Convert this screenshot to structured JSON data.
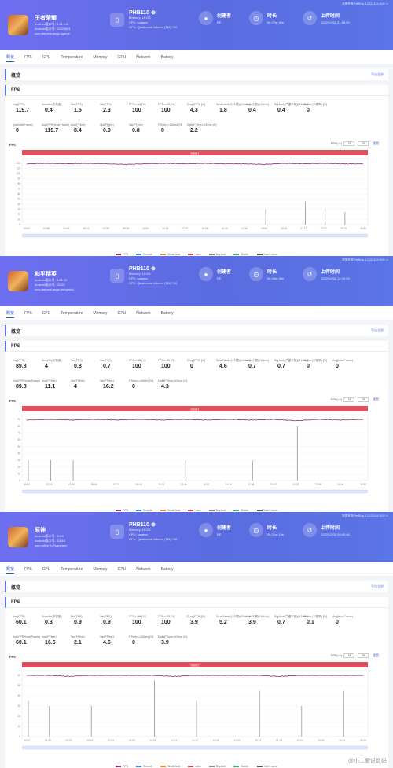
{
  "panels": [
    {
      "game": {
        "name": "王者荣耀",
        "meta1": "Android版本号: 3.81.1.8",
        "meta2": "Android版本号: 20220801",
        "pkg": "com.tencent.tmgp.sgame",
        "icon": "game-icon-warrior"
      },
      "device": {
        "name": "PHB110 ⊕",
        "line1": "Memory: 16.0G",
        "line2": "CPU: kalama",
        "line3": "GPU: Qualcomm Adreno (TM) 740",
        "icon": "phone-icon"
      },
      "stats": [
        {
          "label": "创建者",
          "value": "EE",
          "icon": "user-icon"
        },
        {
          "label": "时长",
          "value": "0h 27m 30s",
          "icon": "clock-icon"
        },
        {
          "label": "上传时间",
          "value": "2022/12/02 21:56:00",
          "icon": "history-icon"
        }
      ],
      "header_note": "数据来源:PerfDog 8.2.221104.0000 ⊙",
      "breadcrumb_tab": "概览",
      "tabs": [
        "概览",
        "FPS",
        "CPU",
        "Temperature",
        "Memory",
        "GPU",
        "Network",
        "Battery"
      ],
      "section_title": "概览",
      "section_link": "导出全部",
      "fps_title": "FPS",
      "metric_rows": [
        [
          {
            "label": "Avg(FPS)",
            "value": "119.7"
          },
          {
            "label": "Smooth(平滑度)",
            "value": "0.4"
          },
          {
            "label": "Std(FPS)",
            "value": "1.5"
          },
          {
            "label": "Var(FPS)",
            "value": "2.3"
          },
          {
            "label": "FPS>=18 [%]",
            "value": "100"
          },
          {
            "label": "FPS>=25 [%]",
            "value": "100"
          },
          {
            "label": "Drop(FPS) [/h]",
            "value": "4.3"
          },
          {
            "label": "SmallJank(小卡顿)(/10min)",
            "value": "1.8"
          },
          {
            "label": "Jank(卡顿)(/10min)",
            "value": "0.4"
          },
          {
            "label": "BigJank(严重卡顿)(/10min)",
            "value": "0.4"
          },
          {
            "label": "Stutter(卡顿率) [%]",
            "value": "0"
          }
        ],
        [
          {
            "label": "Avg(InterFrame)",
            "value": "0"
          },
          {
            "label": "Avg(FPS+InterFrame)",
            "value": "119.7"
          },
          {
            "label": "Avg(FTime)",
            "value": "8.4"
          },
          {
            "label": "Std(FTime)",
            "value": "0.9"
          },
          {
            "label": "Var(FTime)",
            "value": "0.8"
          },
          {
            "label": "FTime>=100ms [%]",
            "value": "0"
          },
          {
            "label": "DeltaFTime>100ms [/h]",
            "value": "2.2"
          }
        ]
      ],
      "chart": {
        "label": "FPS",
        "controls_label": "FPS(>=)",
        "ctl1": "18",
        "ctl2": "25",
        "ctl_btn": "重置",
        "banner": "label1",
        "legend": [
          "FPS",
          "Smooth",
          "SmallJank",
          "Jank",
          "BigJank",
          "Stutter",
          "InterFrame"
        ]
      }
    },
    {
      "game": {
        "name": "和平精英",
        "meta1": "Android版本号: 1.21.19",
        "meta2": "Android版本号: 11120",
        "pkg": "com.tencent.tmgp.pubgmhd",
        "icon": "game-icon-soldier"
      },
      "device": {
        "name": "PHB110 ⊕",
        "line1": "Memory: 16.0G",
        "line2": "CPU: kalama",
        "line3": "GPU: Qualcomm Adreno (TM) 740",
        "icon": "phone-icon"
      },
      "stats": [
        {
          "label": "创建者",
          "value": "EE",
          "icon": "user-icon"
        },
        {
          "label": "时长",
          "value": "0h 28m 58s",
          "icon": "clock-icon"
        },
        {
          "label": "上传时间",
          "value": "2022/12/02 14:10:02",
          "icon": "history-icon"
        }
      ],
      "header_note": "数据来源:PerfDog 8.2.221104.0000 ⊙",
      "breadcrumb_tab": "概览",
      "tabs": [
        "概览",
        "FPS",
        "CPU",
        "Temperature",
        "Memory",
        "GPU",
        "Network",
        "Battery"
      ],
      "section_title": "概览",
      "section_link": "导出全部",
      "fps_title": "FPS",
      "metric_rows": [
        [
          {
            "label": "Avg(FPS)",
            "value": "89.8"
          },
          {
            "label": "Smooth(平滑度)",
            "value": "4"
          },
          {
            "label": "Std(FPS)",
            "value": "0.8"
          },
          {
            "label": "Var(FPS)",
            "value": "0.7"
          },
          {
            "label": "FPS>=18 [%]",
            "value": "100"
          },
          {
            "label": "FPS>=25 [%]",
            "value": "100"
          },
          {
            "label": "Drop(FPS) [/h]",
            "value": "0"
          },
          {
            "label": "SmallJank(小卡顿)(/10min)",
            "value": "4.6"
          },
          {
            "label": "Jank(卡顿)(/10min)",
            "value": "0.7"
          },
          {
            "label": "BigJank(严重卡顿)(/10min)",
            "value": "0.7"
          },
          {
            "label": "Stutter(卡顿率) [%]",
            "value": "0"
          },
          {
            "label": "Avg(InterFrame)",
            "value": "0"
          }
        ],
        [
          {
            "label": "Avg(FPS+InterFrame)",
            "value": "89.8"
          },
          {
            "label": "Avg(FTime)",
            "value": "11.1"
          },
          {
            "label": "Std(FTime)",
            "value": "4"
          },
          {
            "label": "Var(FTime)",
            "value": "16.2"
          },
          {
            "label": "FTime>=100ms [%]",
            "value": "0"
          },
          {
            "label": "DeltaFTime>100ms [/h]",
            "value": "4.3"
          }
        ]
      ],
      "chart": {
        "label": "FPS",
        "controls_label": "FPS(>=)",
        "ctl1": "18",
        "ctl2": "25",
        "ctl_btn": "重置",
        "banner": "label1",
        "legend": [
          "FPS",
          "Smooth",
          "SmallJank",
          "Jank",
          "BigJank",
          "Stutter",
          "InterFrame"
        ]
      }
    },
    {
      "game": {
        "name": "原神",
        "meta1": "Android版本号: 3.2.0",
        "meta2": "Android版本号: 11846",
        "pkg": "com.miHoYo.Yuanshen",
        "icon": "game-icon-genshin"
      },
      "device": {
        "name": "PHB110 ⊕",
        "line1": "Memory: 16.0G",
        "line2": "CPU: kalama",
        "line3": "GPU: Qualcomm Adreno (TM) 740",
        "icon": "phone-icon"
      },
      "stats": [
        {
          "label": "创建者",
          "value": "EE",
          "icon": "user-icon"
        },
        {
          "label": "时长",
          "value": "0h 31m 19s",
          "icon": "clock-icon"
        },
        {
          "label": "上传时间",
          "value": "2022/12/02 09:05:46",
          "icon": "history-icon"
        }
      ],
      "header_note": "数据来源:PerfDog 8.2.221104.0000 ⊙",
      "breadcrumb_tab": "概览",
      "tabs": [
        "概览",
        "FPS",
        "CPU",
        "Temperature",
        "Memory",
        "GPU",
        "Network",
        "Battery"
      ],
      "section_title": "概览",
      "section_link": "导出全部",
      "fps_title": "FPS",
      "metric_rows": [
        [
          {
            "label": "Avg(FPS)",
            "value": "60.1"
          },
          {
            "label": "Smooth(平滑度)",
            "value": "0.3"
          },
          {
            "label": "Std(FPS)",
            "value": "0.9"
          },
          {
            "label": "Var(FPS)",
            "value": "0.9"
          },
          {
            "label": "FPS>=18 [%]",
            "value": "100"
          },
          {
            "label": "FPS>=25 [%]",
            "value": "100"
          },
          {
            "label": "Drop(FPS) [/h]",
            "value": "3.9"
          },
          {
            "label": "SmallJank(小卡顿)(/10min)",
            "value": "5.2"
          },
          {
            "label": "Jank(卡顿)(/10min)",
            "value": "3.9"
          },
          {
            "label": "BigJank(严重卡顿)(/10min)",
            "value": "0.7"
          },
          {
            "label": "Stutter(卡顿率) [%]",
            "value": "0.1"
          },
          {
            "label": "Avg(InterFrame)",
            "value": "0"
          }
        ],
        [
          {
            "label": "Avg(FPS+InterFrame)",
            "value": "60.1"
          },
          {
            "label": "Avg(FTime)",
            "value": "16.6"
          },
          {
            "label": "Std(FTime)",
            "value": "2.1"
          },
          {
            "label": "Var(FTime)",
            "value": "4.6"
          },
          {
            "label": "FTime>=100ms [%]",
            "value": "0"
          },
          {
            "label": "DeltaFTime>100ms [/h]",
            "value": "3.9"
          }
        ]
      ],
      "chart": {
        "label": "FPS",
        "controls_label": "FPS(>=)",
        "ctl1": "18",
        "ctl2": "25",
        "ctl_btn": "重置",
        "banner": "label1",
        "legend": [
          "FPS",
          "Smooth",
          "SmallJank",
          "Jank",
          "BigJank",
          "Stutter",
          "InterFrame"
        ]
      }
    }
  ],
  "watermark": "@小二爱说数码",
  "colors": {
    "header": "#5b74e6",
    "fps_line": "#8b2d72",
    "banner": "#e0505f",
    "spike": "#a8a8a8",
    "accent": "#2f5bdc"
  },
  "chart_data": [
    {
      "type": "line",
      "ylim": [
        0,
        120
      ],
      "yticks": [
        "0",
        "10",
        "20",
        "30",
        "40",
        "50",
        "60",
        "70",
        "80",
        "90",
        "100",
        "110",
        "120"
      ],
      "x": [
        "00:00",
        "02:56",
        "04:46",
        "06:12",
        "07:26",
        "09:28",
        "10:52",
        "12:18",
        "13:40",
        "15:06",
        "16:30",
        "17:48",
        "19:06",
        "20:44",
        "22:12",
        "23:52",
        "25:10",
        "26:34"
      ],
      "series": [
        {
          "name": "FPS",
          "values": [
            119,
            120,
            119,
            120,
            119,
            118,
            119,
            120,
            119,
            120,
            119,
            119,
            118,
            120,
            119,
            120,
            119,
            119
          ]
        }
      ],
      "spikes": [
        {
          "x": "19:06",
          "value": 30
        },
        {
          "x": "22:12",
          "value": 45
        },
        {
          "x": "23:52",
          "value": 30
        },
        {
          "x": "25:10",
          "value": 25
        }
      ]
    },
    {
      "type": "line",
      "ylim": [
        0,
        90
      ],
      "yticks": [
        "0",
        "10",
        "20",
        "30",
        "40",
        "50",
        "60",
        "70",
        "80",
        "90"
      ],
      "x": [
        "00:00",
        "02:14",
        "03:56",
        "05:40",
        "07:22",
        "09:16",
        "11:02",
        "12:46",
        "14:32",
        "16:14",
        "17:58",
        "19:42",
        "21:22",
        "22:58",
        "24:44",
        "26:30"
      ],
      "series": [
        {
          "name": "FPS",
          "values": [
            89,
            90,
            89,
            90,
            89,
            90,
            89,
            90,
            89,
            90,
            89,
            90,
            88,
            90,
            89,
            90
          ]
        }
      ],
      "spikes": [
        {
          "x": "00:00",
          "value": 30
        },
        {
          "x": "02:14",
          "value": 30
        },
        {
          "x": "03:56",
          "value": 30
        },
        {
          "x": "12:46",
          "value": 30
        },
        {
          "x": "17:58",
          "value": 30
        },
        {
          "x": "21:22",
          "value": 80
        }
      ]
    },
    {
      "type": "line",
      "ylim": [
        0,
        60
      ],
      "yticks": [
        "0",
        "10",
        "20",
        "30",
        "40",
        "50",
        "60"
      ],
      "x": [
        "00:00",
        "01:48",
        "03:32",
        "05:18",
        "07:04",
        "08:50",
        "10:38",
        "12:24",
        "14:10",
        "15:56",
        "17:42",
        "19:28",
        "21:14",
        "23:00",
        "24:46",
        "26:32",
        "28:18"
      ],
      "series": [
        {
          "name": "FPS",
          "values": [
            60,
            60,
            59,
            60,
            60,
            60,
            60,
            59,
            60,
            60,
            60,
            60,
            59,
            60,
            60,
            60,
            60
          ]
        }
      ],
      "spikes": [
        {
          "x": "00:00",
          "value": 35
        },
        {
          "x": "01:48",
          "value": 30
        },
        {
          "x": "05:18",
          "value": 30
        },
        {
          "x": "10:38",
          "value": 55
        },
        {
          "x": "14:10",
          "value": 35
        },
        {
          "x": "19:28",
          "value": 45
        },
        {
          "x": "23:00",
          "value": 30
        },
        {
          "x": "26:32",
          "value": 45
        }
      ]
    }
  ]
}
